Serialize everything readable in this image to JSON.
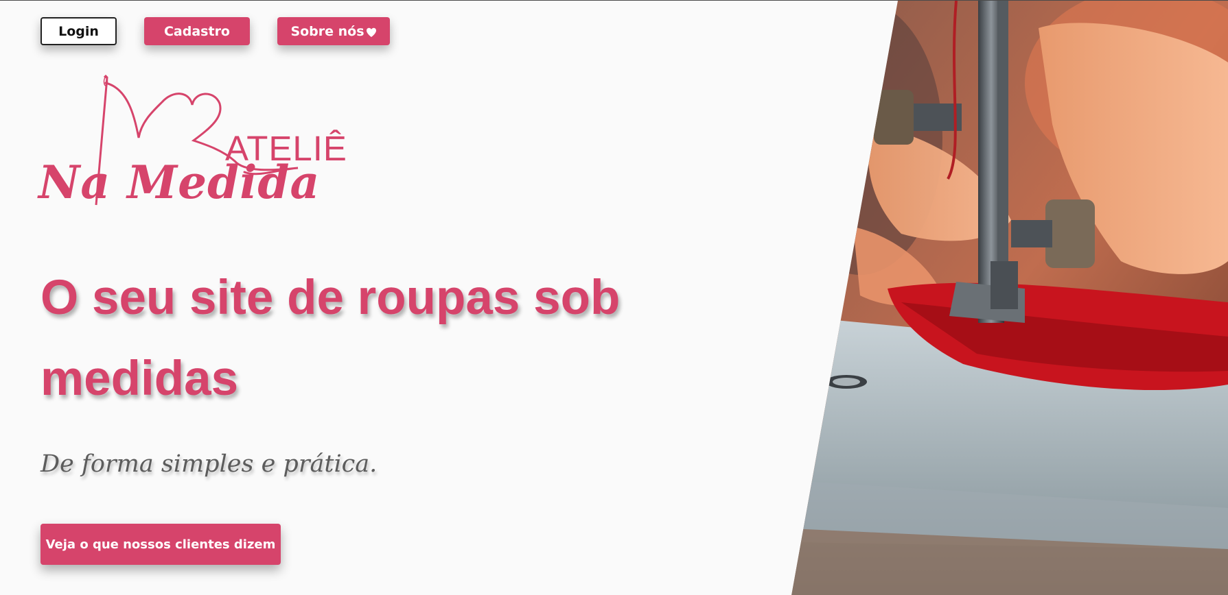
{
  "nav": {
    "login_label": "Login",
    "signup_label": "Cadastro",
    "about_label": "Sobre nós"
  },
  "logo": {
    "line1": "ATELIÊ",
    "line2": "Na Medida"
  },
  "hero": {
    "headline": "O seu site de roupas sob medidas",
    "tagline": "De forma simples e prática.",
    "cta_label": "Veja o que nossos clientes dizem",
    "image_subject": "sewing machine stitching red fabric"
  },
  "colors": {
    "brand": "#d6446b",
    "background": "#fafafa",
    "tagline": "#5c5c5c"
  },
  "icons": {
    "about_icon": "heart-icon"
  }
}
